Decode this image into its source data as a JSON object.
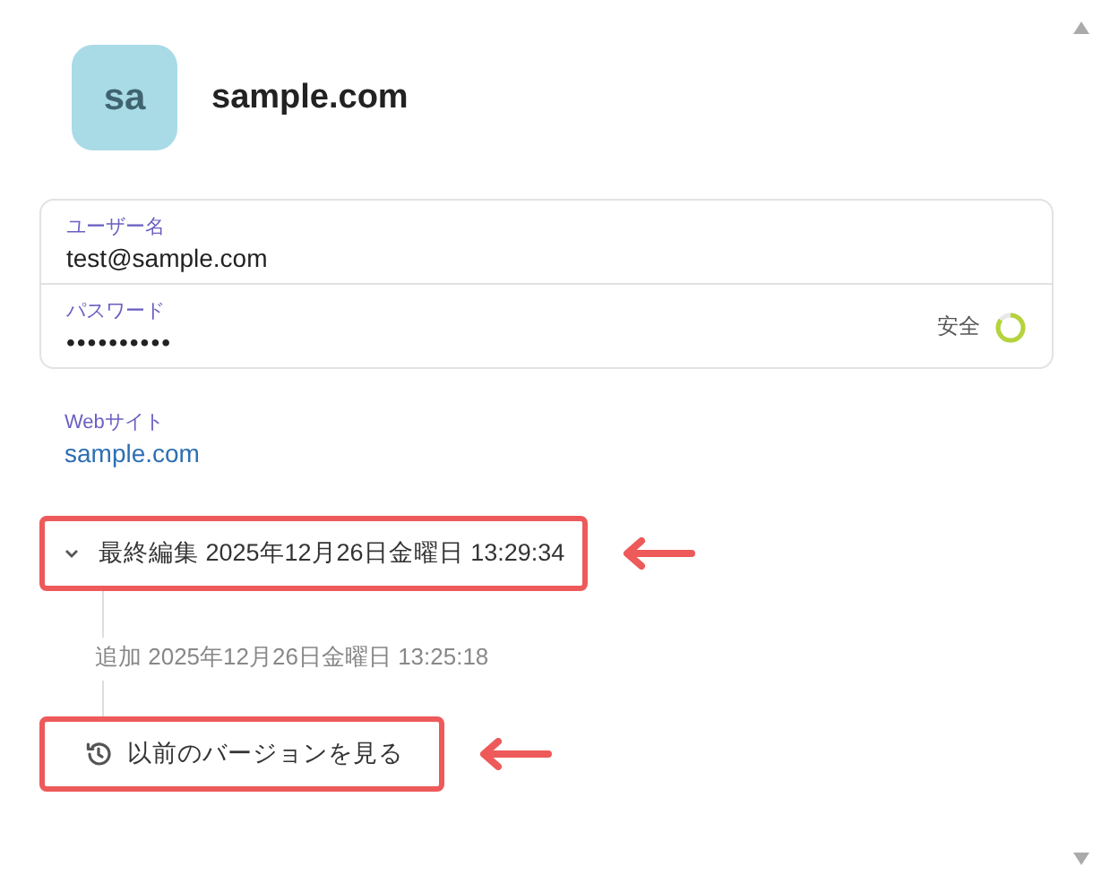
{
  "header": {
    "avatar": "sa",
    "title": "sample.com"
  },
  "credentials": [
    {
      "kind": "text",
      "label": "ユーザー名",
      "value": "test@sample.com"
    },
    {
      "kind": "password",
      "label": "パスワード",
      "value": "••••••••••",
      "strength": "安全",
      "level": 0.85
    }
  ],
  "website": {
    "label": "Webサイト",
    "url": "sample.com"
  },
  "history": {
    "expanded": true,
    "last_edited": "最終編集 2025年12月26日金曜日 13:29:34",
    "added": "追加 2025年12月26日金曜日 13:25:18",
    "versions_button": "以前のバージョンを見る"
  }
}
